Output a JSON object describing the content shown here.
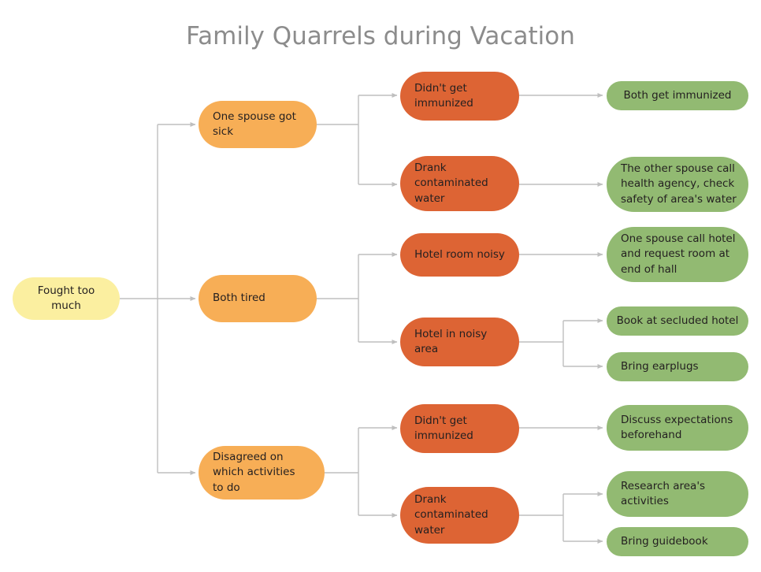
{
  "title": "Family Quarrels during Vacation",
  "colors": {
    "title_text": "#8c8c8c",
    "root_fill": "#fbefa0",
    "cause_fill": "#f7ae56",
    "sub_fill": "#dd6434",
    "action_fill": "#92ba72",
    "connector": "#bfbfbf",
    "node_text": "#231f20",
    "background": "#ffffff"
  },
  "diagram": {
    "type": "tree-fishbone-problem-solution",
    "root": {
      "id": "root",
      "label": "Fought too\nmuch"
    },
    "causes": [
      {
        "id": "cause-1",
        "label": "One spouse got\nsick",
        "subcauses": [
          {
            "id": "sub-1-1",
            "label": "Didn't get\nimmunized",
            "actions": [
              {
                "id": "action-1-1-1",
                "label": "Both get immunized"
              }
            ]
          },
          {
            "id": "sub-1-2",
            "label": "Drank\ncontaminated\nwater",
            "actions": [
              {
                "id": "action-1-2-1",
                "label": "The other spouse call\nhealth agency, check\nsafety of area's water"
              }
            ]
          }
        ]
      },
      {
        "id": "cause-2",
        "label": "Both tired",
        "subcauses": [
          {
            "id": "sub-2-1",
            "label": "Hotel room noisy",
            "actions": [
              {
                "id": "action-2-1-1",
                "label": "One spouse call hotel\nand request room at\nend of hall"
              }
            ]
          },
          {
            "id": "sub-2-2",
            "label": "Hotel in noisy\narea",
            "actions": [
              {
                "id": "action-2-2-1",
                "label": "Book at secluded hotel"
              },
              {
                "id": "action-2-2-2",
                "label": "Bring earplugs"
              }
            ]
          }
        ]
      },
      {
        "id": "cause-3",
        "label": "Disagreed on\nwhich activities\nto do",
        "subcauses": [
          {
            "id": "sub-3-1",
            "label": "Didn't get\nimmunized",
            "actions": [
              {
                "id": "action-3-1-1",
                "label": "Discuss expectations\nbeforehand"
              }
            ]
          },
          {
            "id": "sub-3-2",
            "label": "Drank\ncontaminated\nwater",
            "actions": [
              {
                "id": "action-3-2-1",
                "label": "Research area's\nactivities"
              },
              {
                "id": "action-3-2-2",
                "label": "Bring guidebook"
              }
            ]
          }
        ]
      }
    ]
  }
}
